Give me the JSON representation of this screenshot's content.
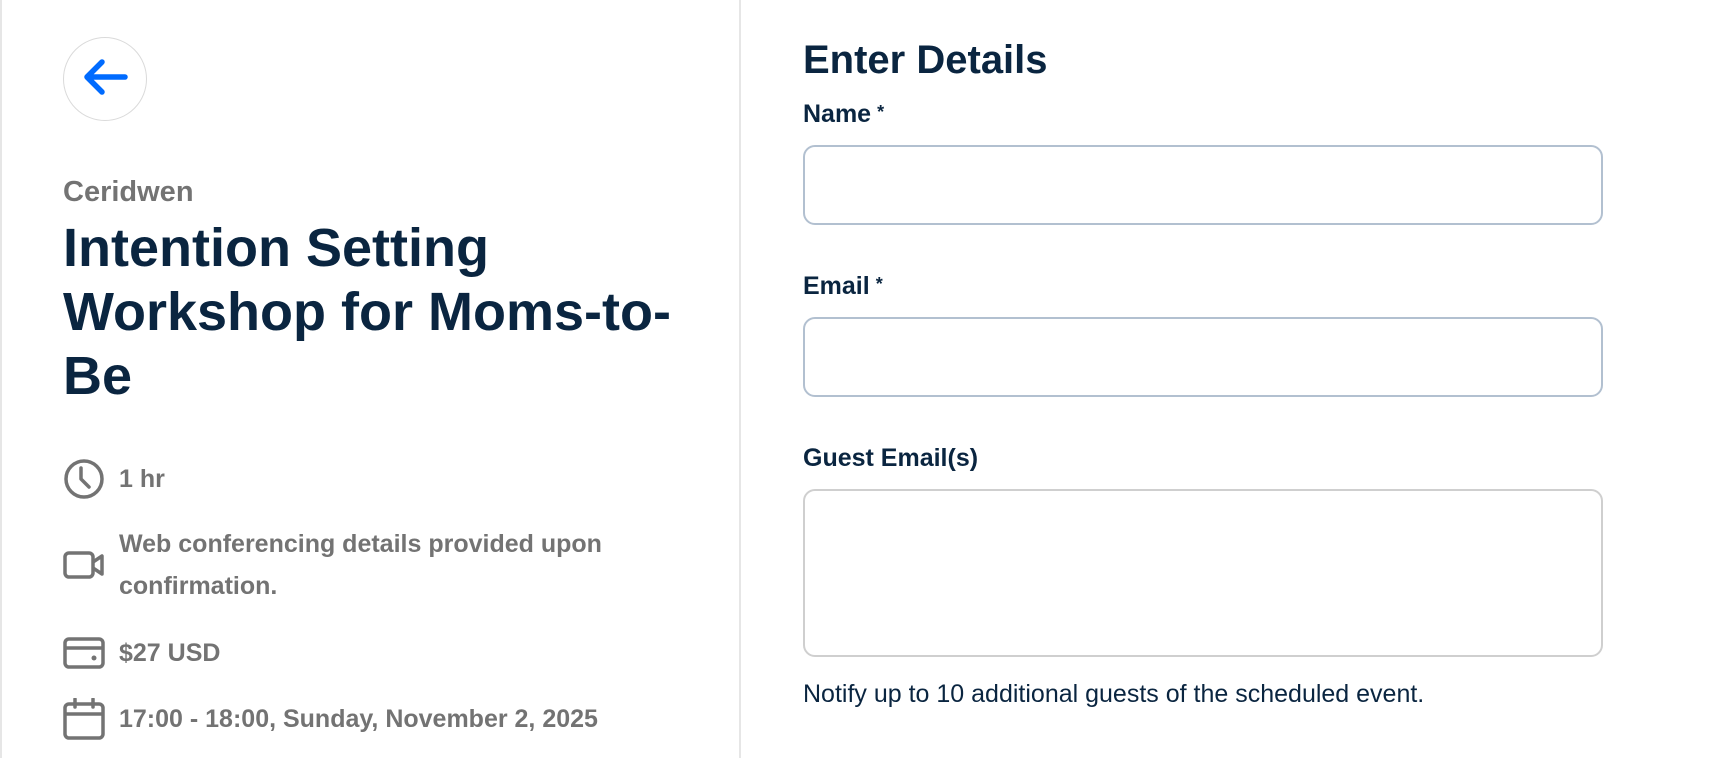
{
  "event": {
    "organizer": "Ceridwen",
    "title": "Intention Setting Workshop for Moms-to-Be",
    "details": {
      "duration": "1 hr",
      "location": "Web conferencing details provided upon confirmation.",
      "price": "$27 USD",
      "datetime": "17:00 - 18:00, Sunday, November 2, 2025"
    },
    "icons": {
      "back": "arrow-left-icon",
      "duration": "clock-icon",
      "location": "video-camera-icon",
      "price": "credit-card-icon",
      "datetime": "calendar-icon"
    }
  },
  "form": {
    "title": "Enter Details",
    "name": {
      "label": "Name",
      "required_mark": "*",
      "value": "",
      "placeholder": ""
    },
    "email": {
      "label": "Email",
      "required_mark": "*",
      "value": "",
      "placeholder": ""
    },
    "guests": {
      "label": "Guest Email(s)",
      "value": "",
      "help": "Notify up to 10 additional guests of the scheduled event."
    }
  },
  "colors": {
    "accent": "#006bff",
    "heading": "#0a2540",
    "muted": "#737373",
    "input_border": "#b2c0d0"
  }
}
